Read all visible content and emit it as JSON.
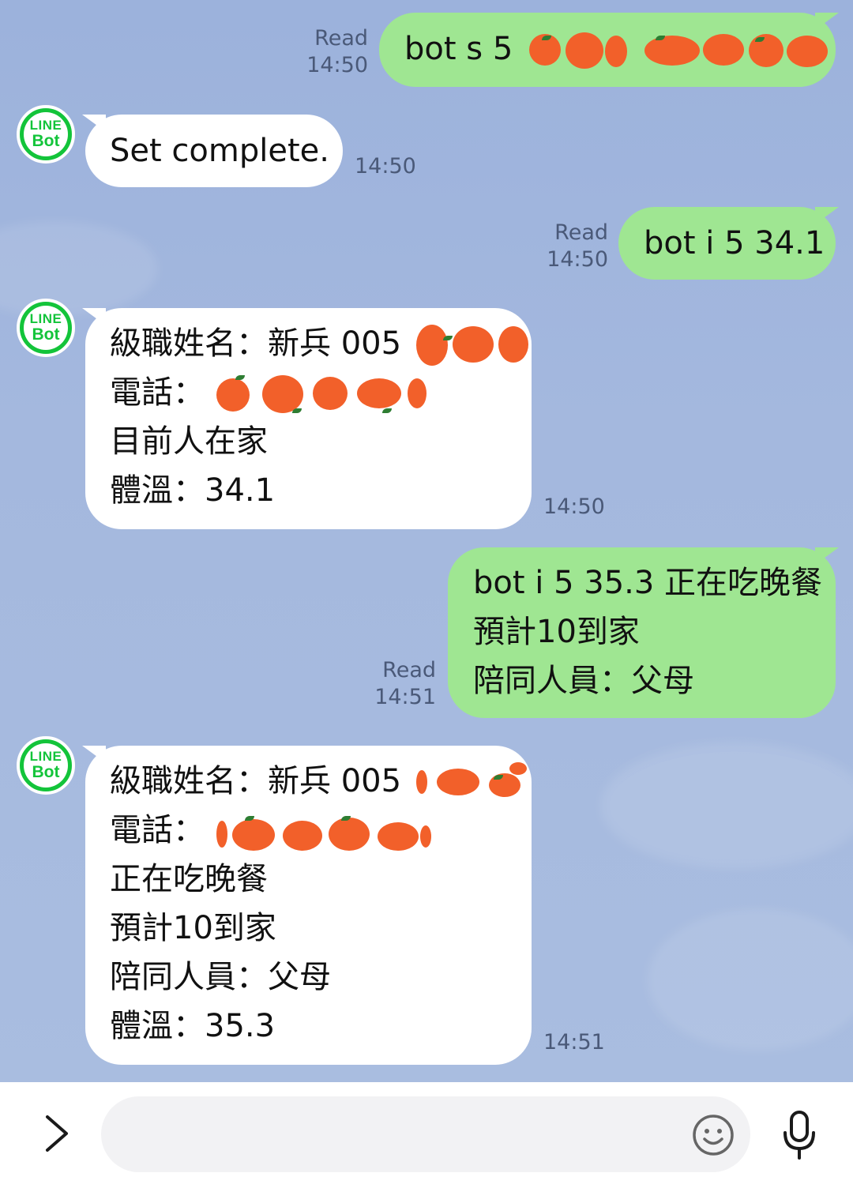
{
  "messages": [
    {
      "side": "out",
      "lines": [
        "bot s 5"
      ],
      "status": "Read",
      "time": "14:50"
    },
    {
      "side": "in",
      "sender_avatar": {
        "line1": "LINE",
        "line2": "Bot"
      },
      "lines": [
        "Set complete."
      ],
      "time": "14:50"
    },
    {
      "side": "out",
      "lines": [
        "bot i 5 34.1"
      ],
      "status": "Read",
      "time": "14:50"
    },
    {
      "side": "in",
      "sender_avatar": {
        "line1": "LINE",
        "line2": "Bot"
      },
      "lines": [
        "級職姓名：新兵 005",
        "電話：",
        "目前人在家",
        "體溫：34.1"
      ],
      "time": "14:50"
    },
    {
      "side": "out",
      "lines": [
        "bot i 5 35.3 正在吃晚餐",
        "預計10到家",
        "陪同人員：父母"
      ],
      "status": "Read",
      "time": "14:51"
    },
    {
      "side": "in",
      "sender_avatar": {
        "line1": "LINE",
        "line2": "Bot"
      },
      "lines": [
        "級職姓名：新兵 005",
        "電話：",
        "正在吃晚餐",
        "預計10到家",
        "陪同人員：父母",
        "體溫：35.3"
      ],
      "time": "14:51"
    }
  ],
  "input_bar": {
    "expand_icon": "chevron-right-icon",
    "message_placeholder": "",
    "emoji_icon": "smiley-icon",
    "mic_icon": "microphone-icon"
  },
  "colors": {
    "background": "#9db3db",
    "outgoing_bubble": "#9fe692",
    "incoming_bubble": "#ffffff",
    "line_green": "#13c43a",
    "redaction_orange": "#f2602a"
  }
}
